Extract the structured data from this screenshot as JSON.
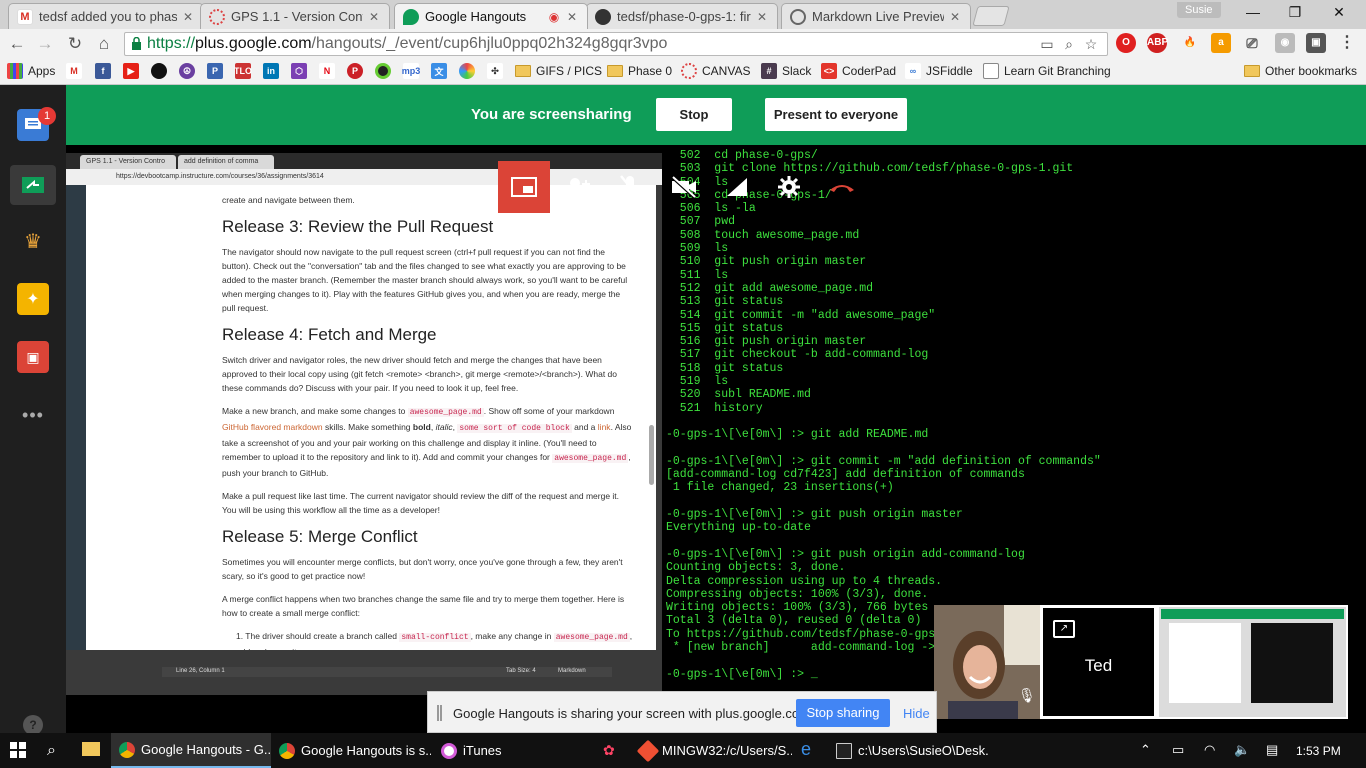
{
  "browser": {
    "tabs": [
      {
        "label": "tedsf added you to phase",
        "icon": "gmail-icon",
        "active": false
      },
      {
        "label": "GPS 1.1 - Version Control",
        "icon": "canvas-icon",
        "active": false
      },
      {
        "label": "Google Hangouts",
        "icon": "hangouts-icon",
        "active": true
      },
      {
        "label": "tedsf/phase-0-gps-1: first",
        "icon": "github-icon",
        "active": false
      },
      {
        "label": "Markdown Live Preview",
        "icon": "markdown-icon",
        "active": false
      }
    ],
    "profile_name": "Susie",
    "url": {
      "scheme": "https://",
      "domain": "plus.google.com",
      "path": "/hangouts/_/event/cup6hjlu0ppq02h324g8gqr3vpo"
    },
    "bookmarks": [
      {
        "label": "Apps",
        "icon": "apps-grid-icon"
      },
      {
        "label": "",
        "icon": "gmail-icon"
      },
      {
        "label": "",
        "icon": "facebook-icon"
      },
      {
        "label": "",
        "icon": "youtube-icon"
      },
      {
        "label": "",
        "icon": "bomb-icon"
      },
      {
        "label": "",
        "icon": "peace-icon"
      },
      {
        "label": "",
        "icon": "p-icon"
      },
      {
        "label": "",
        "icon": "tlo-icon"
      },
      {
        "label": "",
        "icon": "linkedin-icon"
      },
      {
        "label": "",
        "icon": "hex-icon"
      },
      {
        "label": "",
        "icon": "netflix-icon"
      },
      {
        "label": "",
        "icon": "pinterest-icon"
      },
      {
        "label": "",
        "icon": "circle-icon"
      },
      {
        "label": "",
        "icon": "mp3-icon"
      },
      {
        "label": "",
        "icon": "translate-icon"
      },
      {
        "label": "",
        "icon": "pinwheel-icon"
      },
      {
        "label": "",
        "icon": "slack-dots-icon"
      },
      {
        "label": "GIFS / PICS",
        "icon": "folder-icon"
      },
      {
        "label": "Phase 0",
        "icon": "folder-icon"
      },
      {
        "label": "CANVAS",
        "icon": "canvas-icon"
      },
      {
        "label": "Slack",
        "icon": "slack-icon"
      },
      {
        "label": "CoderPad",
        "icon": "coderpad-icon"
      },
      {
        "label": "JSFiddle",
        "icon": "jsfiddle-icon"
      },
      {
        "label": "Learn Git Branching",
        "icon": "page-icon"
      }
    ],
    "other_bookmarks": "Other bookmarks"
  },
  "hangout": {
    "banner_text": "You are screensharing",
    "stop_label": "Stop",
    "present_label": "Present to everyone",
    "notification_count": "1",
    "participant_name": "Ted",
    "notice_text": "Google Hangouts is sharing your screen with plus.google.com.",
    "stop_sharing_label": "Stop sharing",
    "hide_label": "Hide"
  },
  "shared_browser": {
    "tab1": "GPS 1.1 - Version Contro",
    "tab2": "add definition of comma",
    "url": "https://devbootcamp.instructure.com/courses/36/assignments/3614",
    "status_left": "Line 26, Column 1",
    "status_tab": "Tab Size: 4",
    "status_lang": "Markdown"
  },
  "document": {
    "intro_tail": "create and navigate between them.",
    "h3": "Release 3: Review the Pull Request",
    "p3": "The navigator should now navigate to the pull request screen (ctrl+f pull request if you can not find the button). Check out the \"conversation\" tab and the files changed to see what exactly you are approving to be added to the master branch. (Remember the master branch should always work, so you'll want to be careful when merging changes to it). Play with the features GitHub gives you, and when you are ready, merge the pull request.",
    "h4": "Release 4: Fetch and Merge",
    "p4": "Switch driver and navigator roles, the new driver should fetch and merge the changes that have been approved to their local copy using (git fetch <remote> <branch>, git merge <remote>/<branch>). What do these commands do? Discuss with your pair. If you need to look it up, feel free.",
    "p4b_a": "Make a new branch, and make some changes to",
    "code_awesome": "awesome_page.md",
    "p4b_b": ". Show off some of your markdown",
    "link_gfm": "GitHub flavored markdown",
    "p4b_c": "skills. Make something",
    "bold_word": "bold",
    "italic_word": "italic",
    "code_block": "some sort of code block",
    "p4b_d": "and a",
    "link_word": "link",
    "p4b_e": ". Also take a screenshot of you and your pair working on this challenge and display it inline. (You'll need to remember to upload it to the repository and link to it). Add and commit your changes for",
    "p4b_f": ", push your branch to GitHub.",
    "p4c": "Make a pull request like last time. The current navigator should review the diff of the request and merge it. You will be using this workflow all the time as a developer!",
    "h5": "Release 5: Merge Conflict",
    "p5": "Sometimes you will encounter merge conflicts, but don't worry, once you've gone through a few, they aren't scary, so it's good to get practice now!",
    "p5b": "A merge conflict happens when two branches change the same file and try to merge them together. Here is how to create a small merge conflict:",
    "li1_a": "1. The driver should create a branch called",
    "code_small": "small-conflict",
    "li1_b": ", make any change in",
    "li1_c": ", add and commit."
  },
  "terminal": {
    "lines": [
      "  502  cd phase-0-gps/",
      "  503  git clone https://github.com/tedsf/phase-0-gps-1.git",
      "  504  ls",
      "  505  cd phase-0-gps-1/",
      "  506  ls -la",
      "  507  pwd",
      "  508  touch awesome_page.md",
      "  509  ls",
      "  510  git push origin master",
      "  511  ls",
      "  512  git add awesome_page.md",
      "  513  git status",
      "  514  git commit -m \"add awesome_page\"",
      "  515  git status",
      "  516  git push origin master",
      "  517  git checkout -b add-command-log",
      "  518  git status",
      "  519  ls",
      "  520  subl README.md",
      "  521  history",
      "",
      "-0-gps-1\\[\\e[0m\\] :> git add README.md",
      "",
      "-0-gps-1\\[\\e[0m\\] :> git commit -m \"add definition of commands\"",
      "[add-command-log cd7f423] add definition of commands",
      " 1 file changed, 23 insertions(+)",
      "",
      "-0-gps-1\\[\\e[0m\\] :> git push origin master",
      "Everything up-to-date",
      "",
      "-0-gps-1\\[\\e[0m\\] :> git push origin add-command-log",
      "Counting objects: 3, done.",
      "Delta compression using up to 4 threads.",
      "Compressing objects: 100% (3/3), done.",
      "Writing objects: 100% (3/3), 766 bytes",
      "Total 3 (delta 0), reused 0 (delta 0)",
      "To https://github.com/tedsf/phase-0-gps",
      " * [new branch]      add-command-log ->",
      "",
      "-0-gps-1\\[\\e[0m\\] :> _"
    ]
  },
  "taskbar": {
    "items": [
      {
        "label": "Google Hangouts - G...",
        "icon": "chrome-icon",
        "active": true
      },
      {
        "label": "Google Hangouts is s...",
        "icon": "chrome-icon",
        "active": false
      },
      {
        "label": "iTunes",
        "icon": "itunes-icon",
        "active": false
      },
      {
        "label": "MINGW32:/c/Users/S...",
        "icon": "git-icon",
        "active": false
      },
      {
        "label": "c:\\Users\\SusieO\\Desk...",
        "icon": "cmd-icon",
        "active": false
      }
    ],
    "clock": "1:53 PM"
  },
  "colors": {
    "hangouts_green": "#0f9d58",
    "terminal_green": "#3ee13e",
    "accent_blue": "#4285f4",
    "hangup_red": "#db4437"
  }
}
